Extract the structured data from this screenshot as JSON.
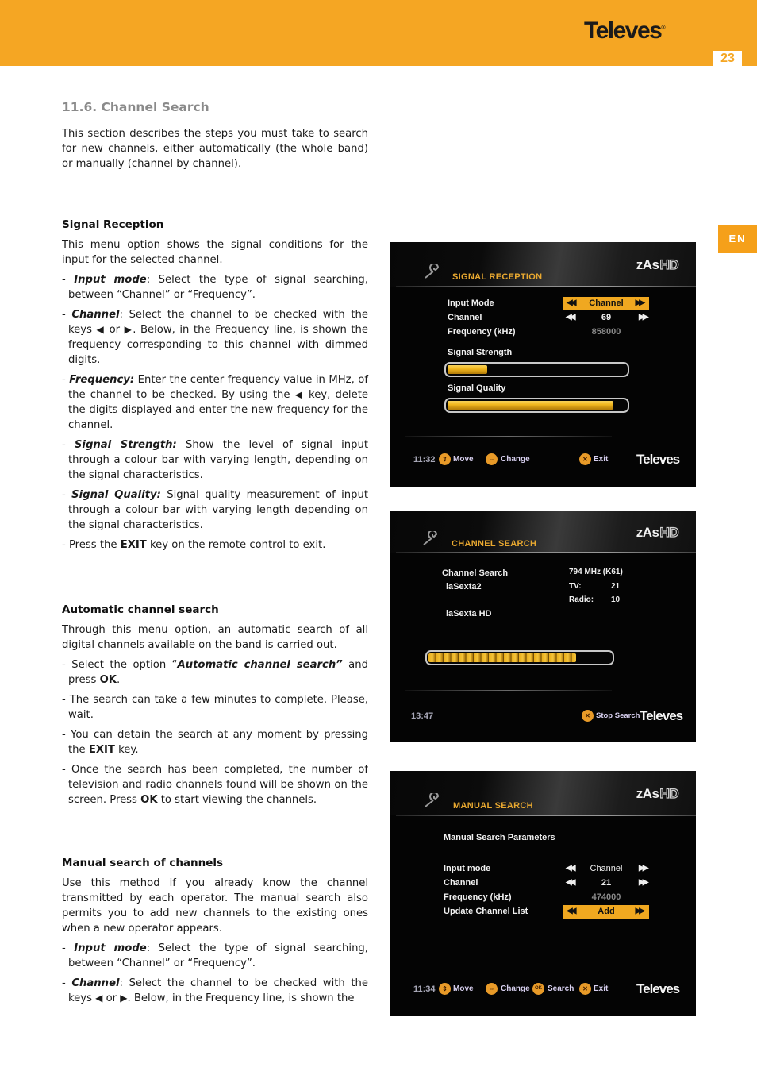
{
  "header": {
    "brand": "Televes",
    "brand_mark": "®",
    "page_number": "23",
    "language_tab": "EN",
    "accent_color": "#f5a623"
  },
  "section": {
    "title": "11.6. Channel Search",
    "intro": "This section describes the steps you must take to search for new channels, either automatically (the whole band) or manually (channel by channel)."
  },
  "signal_reception": {
    "heading": "Signal Reception",
    "intro": "This menu option shows the signal conditions for the input for the selected channel.",
    "bullets": [
      {
        "term": "Input mode",
        "sep": ":",
        "text": " Select the type of signal searching, between “Channel” or “Frequency”."
      },
      {
        "term": "Channel",
        "sep": ":",
        "pre": " Select the channel to be checked with the keys ",
        "mid": " or ",
        "post": ". Below, in the Frequency line, is shown the frequency corresponding to this channel with dimmed digits."
      },
      {
        "term": "Frequency:",
        "pre": " Enter the center frequency value in MHz, of the channel to be checked. By using the ",
        "post": " key, delete the digits displayed and enter the new frequency for the channel."
      },
      {
        "term": "Signal Strength:",
        "text": " Show the level of signal input through a colour bar with varying length, depending on the signal characteristics."
      },
      {
        "term": "Signal Quality:",
        "text": " Signal quality measurement  of input through a colour bar with varying length depending on the signal characteristics."
      },
      {
        "pre": "Press the ",
        "strong": "EXIT",
        "post": " key on the remote control to exit."
      }
    ]
  },
  "automatic_search": {
    "heading": "Automatic channel search",
    "intro": "Through this menu option, an automatic search of all digital channels available on the band is carried out.",
    "bullets": [
      {
        "pre": "Select the option “",
        "term": "Automatic channel search”",
        "mid": " and press ",
        "strong": "OK",
        "post": "."
      },
      {
        "text": "The search can take a few minutes to complete. Please, wait."
      },
      {
        "pre": "You can detain the search at any moment by pressing the ",
        "strong": "EXIT",
        "post": " key."
      },
      {
        "pre": "Once the search has been completed, the number of television and radio channels found will be shown on the screen. Press ",
        "strong": "OK",
        "post": " to start viewing the channels."
      }
    ]
  },
  "manual_search": {
    "heading": "Manual search of channels",
    "intro": "Use this method if you already know the channel transmitted by each operator. The manual search also permits you to add new channels to the existing ones when a new operator appears.",
    "bullets": [
      {
        "term": "Input mode",
        "sep": ":",
        "text": " Select the type of signal searching, between “Channel” or “Frequency”."
      },
      {
        "term": "Channel",
        "sep": ":",
        "pre": " Select the channel to be checked with the keys ",
        "mid": " or ",
        "post": ". Below, in the Frequency line, is shown the"
      }
    ]
  },
  "glyphs": {
    "left_key": "◀",
    "right_key": "▶",
    "rewind": "◀◀",
    "forward": "▶▶",
    "dash": "- "
  },
  "screens": {
    "signal_reception": {
      "logo": "zAs",
      "logo_hd": "HD",
      "title": "SIGNAL RECEPTION",
      "rows": [
        {
          "label": "Input Mode",
          "value": "Channel",
          "selected": true
        },
        {
          "label": "Channel",
          "value": "69"
        },
        {
          "label": "Frequency (kHz)",
          "value": "858000",
          "dimmed": true
        }
      ],
      "strength_label": "Signal Strength",
      "strength_level": 0.22,
      "quality_label": "Signal Quality",
      "quality_level": 0.93,
      "footer": {
        "time": "11:32",
        "actions": [
          {
            "icon": "updown-button-icon",
            "label": "Move"
          },
          {
            "icon": "leftright-button-icon",
            "label": "Change"
          },
          {
            "icon": "exit-button-icon",
            "glyph": "✕",
            "label": "Exit"
          }
        ],
        "brand": "Televes"
      }
    },
    "channel_search": {
      "logo": "zAs",
      "logo_hd": "HD",
      "title": "CHANNEL SEARCH",
      "status_label": "Channel Search",
      "found_channels": [
        "laSexta2",
        "laSexta HD"
      ],
      "frequency": "794 MHz (K61)",
      "tv_label": "TV:",
      "tv_count": "21",
      "radio_label": "Radio:",
      "radio_count": "10",
      "progress": 0.81,
      "footer": {
        "time": "13:47",
        "stop_glyph": "✕",
        "stop_label": "Stop Search",
        "brand": "Televes"
      }
    },
    "manual_search": {
      "logo": "zAs",
      "logo_hd": "HD",
      "title": "MANUAL SEARCH",
      "params_heading": "Manual Search Parameters",
      "rows": [
        {
          "label": "Input mode",
          "value": "Channel"
        },
        {
          "label": "Channel",
          "value": "21"
        },
        {
          "label": "Frequency (kHz)",
          "value": "474000",
          "dimmed": true
        },
        {
          "label": "Update Channel List",
          "value": "Add",
          "selected": true
        }
      ],
      "footer": {
        "time": "11:34",
        "actions": [
          {
            "icon": "updown-button-icon",
            "label": "Move"
          },
          {
            "icon": "leftright-button-icon",
            "label": "Change"
          },
          {
            "icon": "ok-button-icon",
            "glyph": "OK",
            "label": "Search"
          },
          {
            "icon": "exit-button-icon",
            "glyph": "✕",
            "label": "Exit"
          }
        ],
        "brand": "Televes"
      }
    }
  }
}
